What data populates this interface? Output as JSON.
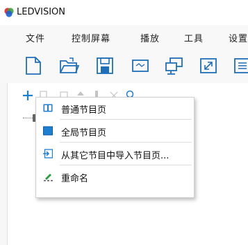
{
  "window": {
    "title": "LEDVISION"
  },
  "menu": {
    "items": [
      "文件",
      "控制屏幕",
      "播放",
      "工具",
      "设置"
    ]
  },
  "toolbar": {
    "icons": [
      "new-file-icon",
      "open-folder-icon",
      "save-icon",
      "screen-icon",
      "network-icon",
      "fullscreen-icon",
      "list-icon"
    ]
  },
  "panel_toolbar": {
    "icons": [
      "add-icon",
      "copy-icon",
      "paste-icon",
      "move-up-icon",
      "move-down-icon",
      "delete-icon",
      "search-icon"
    ]
  },
  "context_menu": {
    "items": [
      {
        "label": "普通节目页",
        "icon": "normal-page-icon"
      },
      {
        "label": "全局节目页",
        "icon": "global-page-icon"
      },
      {
        "label": "从其它节目中导入节目页...",
        "icon": "import-page-icon"
      },
      {
        "label": "重命名",
        "icon": "rename-icon"
      }
    ]
  },
  "colors": {
    "accent": "#1e7fd0",
    "menubar_bg": "#f8f8f8",
    "icon_blue": "#1f6fb8"
  }
}
